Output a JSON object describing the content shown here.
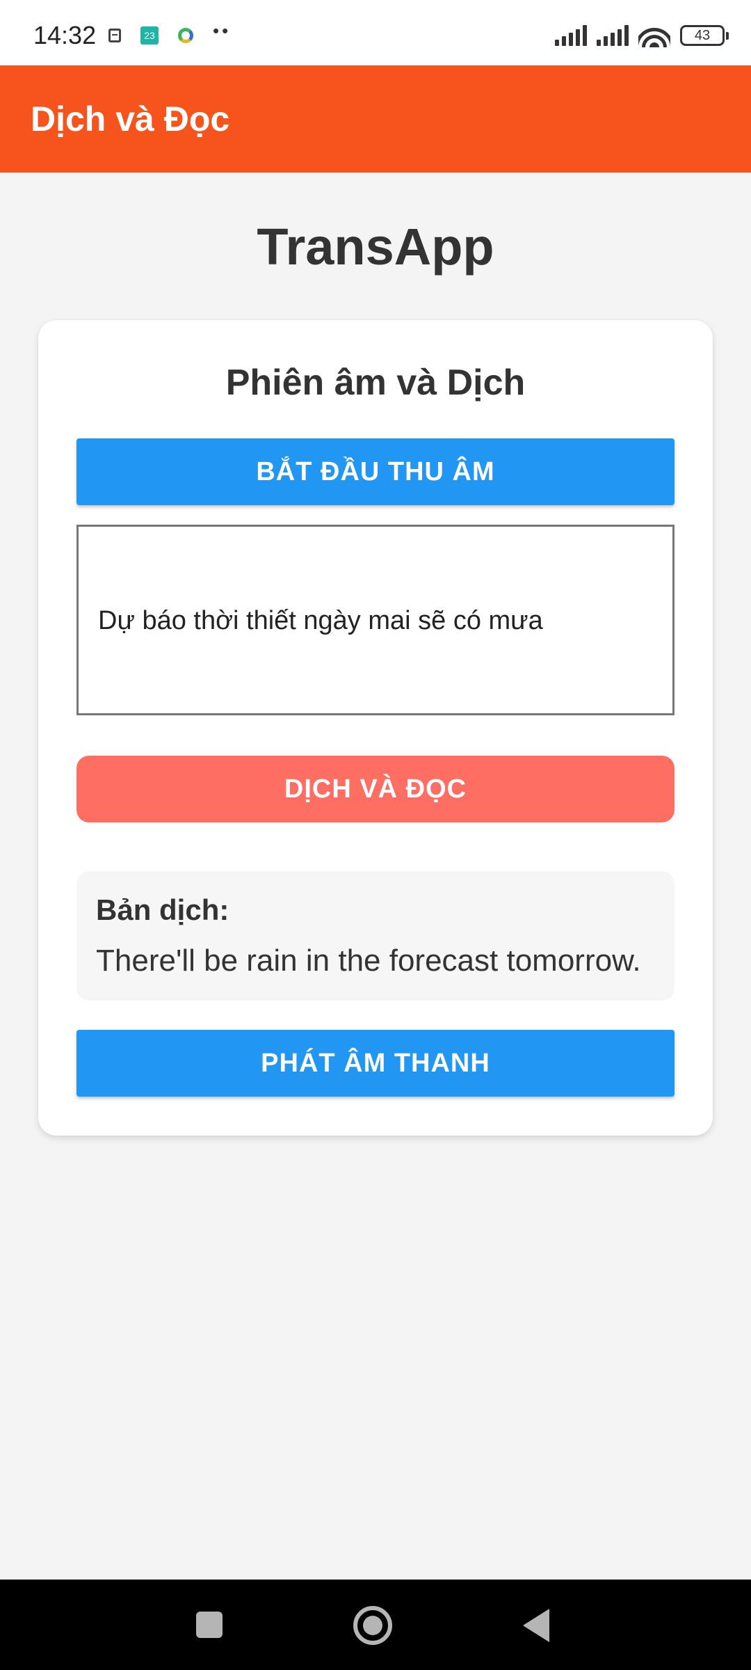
{
  "status_bar": {
    "time": "14:32",
    "app_badge": "23",
    "overflow_dots": "••",
    "battery_level": "43",
    "icons": [
      "calendar-icon",
      "app-notification-icon",
      "sync-icon",
      "more-notifications-icon",
      "signal-icon",
      "signal-icon",
      "wifi-icon",
      "battery-icon"
    ]
  },
  "app_bar": {
    "title": "Dịch và Đọc"
  },
  "page": {
    "title": "TransApp"
  },
  "card": {
    "title": "Phiên âm và Dịch",
    "record_button": "BẮT ĐẦU THU ÂM",
    "transcript_text": "Dự báo thời thiết ngày mai sẽ có mưa",
    "translate_button": "DỊCH VÀ ĐỌC",
    "result": {
      "label": "Bản dịch:",
      "text": "There'll be rain in the forecast tomorrow."
    },
    "play_button": "PHÁT ÂM THANH"
  },
  "nav_bar": {
    "icons": [
      "recents-icon",
      "home-icon",
      "back-icon"
    ]
  },
  "colors": {
    "app_bar": "#f6531d",
    "primary_button": "#2196f3",
    "translate_button": "#ff6e63",
    "background": "#f4f4f4",
    "card": "#ffffff",
    "nav_bar": "#000000"
  }
}
